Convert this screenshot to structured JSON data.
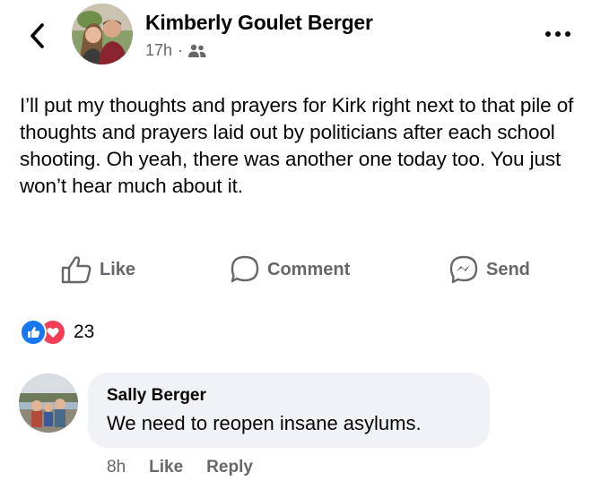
{
  "post": {
    "author": "Kimberly Goulet Berger",
    "time": "17h",
    "separator": "·",
    "audience_icon": "friends-icon",
    "text": "I’ll put my thoughts and prayers for Kirk right next to that pile of thoughts and prayers laid out by politicians after each school shooting. Oh yeah, there was another one today too. You just won’t hear much about it."
  },
  "actions": {
    "like": "Like",
    "comment": "Comment",
    "send": "Send"
  },
  "reactions": {
    "count": "23",
    "types": [
      "like",
      "love"
    ]
  },
  "comment": {
    "author": "Sally Berger",
    "text": "We need to reopen insane asylums.",
    "time": "8h",
    "like": "Like",
    "reply": "Reply"
  },
  "colors": {
    "secondary_text": "#65676b",
    "bubble": "#f0f2f5",
    "like_blue": "#1877f2",
    "love_red": "#f33e58"
  }
}
